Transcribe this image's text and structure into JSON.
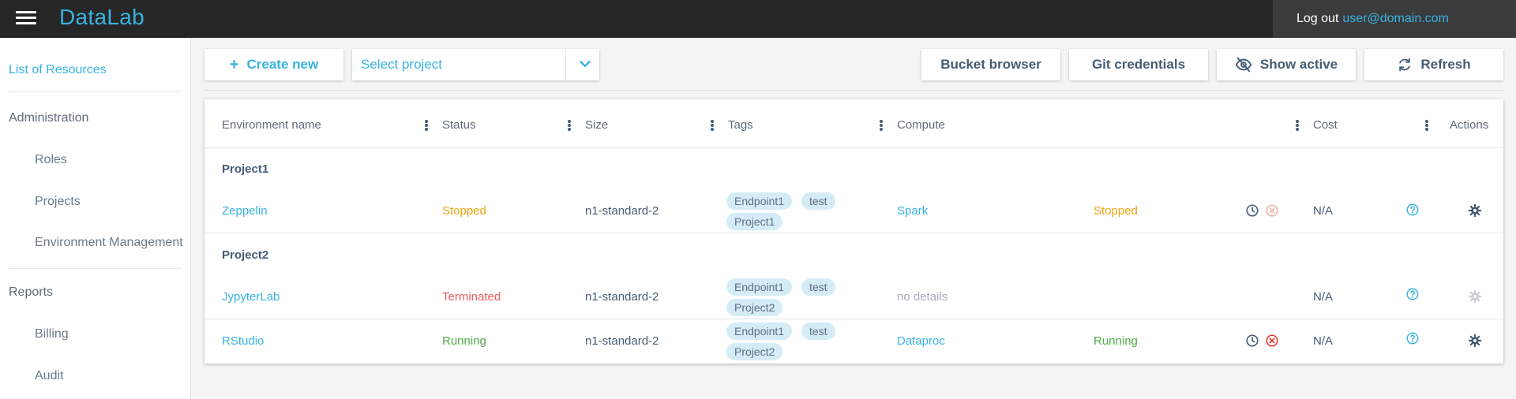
{
  "topbar": {
    "app_name": "DataLab",
    "logout_label": "Log out",
    "user_email": "user@domain.com"
  },
  "sidebar": {
    "items": [
      {
        "label": "List of Resources",
        "active": true
      },
      {
        "label": "Administration"
      },
      {
        "label": "Roles"
      },
      {
        "label": "Projects"
      },
      {
        "label": "Environment Management"
      },
      {
        "label": "Reports"
      },
      {
        "label": "Billing"
      },
      {
        "label": "Audit"
      }
    ]
  },
  "toolbar": {
    "create_label": "Create new",
    "project_placeholder": "Select project",
    "bucket_label": "Bucket browser",
    "git_label": "Git credentials",
    "show_active_label": "Show active",
    "refresh_label": "Refresh"
  },
  "table": {
    "headers": [
      "Environment name",
      "Status",
      "Size",
      "Tags",
      "Compute",
      "Cost",
      "Actions"
    ],
    "groups": [
      {
        "name": "Project1",
        "rows": [
          {
            "env": "Zeppelin",
            "status": "Stopped",
            "size": "n1-standard-2",
            "tags": [
              "Endpoint1",
              "test",
              "Project1"
            ],
            "compute": "Spark",
            "compute_status": "Stopped",
            "cost": "N/A"
          }
        ]
      },
      {
        "name": "Project2",
        "rows": [
          {
            "env": "JypyterLab",
            "status": "Terminated",
            "size": "n1-standard-2",
            "tags": [
              "Endpoint1",
              "test",
              "Project2"
            ],
            "compute": "no details",
            "compute_status": "",
            "cost": "N/A"
          },
          {
            "env": "RStudio",
            "status": "Running",
            "size": "n1-standard-2",
            "tags": [
              "Endpoint1",
              "test",
              "Project2"
            ],
            "compute": "Dataproc",
            "compute_status": "Running",
            "cost": "N/A"
          }
        ]
      }
    ]
  },
  "colors": {
    "accent": "#36b3e0",
    "stopped": "#f1a20d",
    "terminated": "#ef5c5c",
    "running": "#50a94a",
    "topbar": "#262626"
  }
}
